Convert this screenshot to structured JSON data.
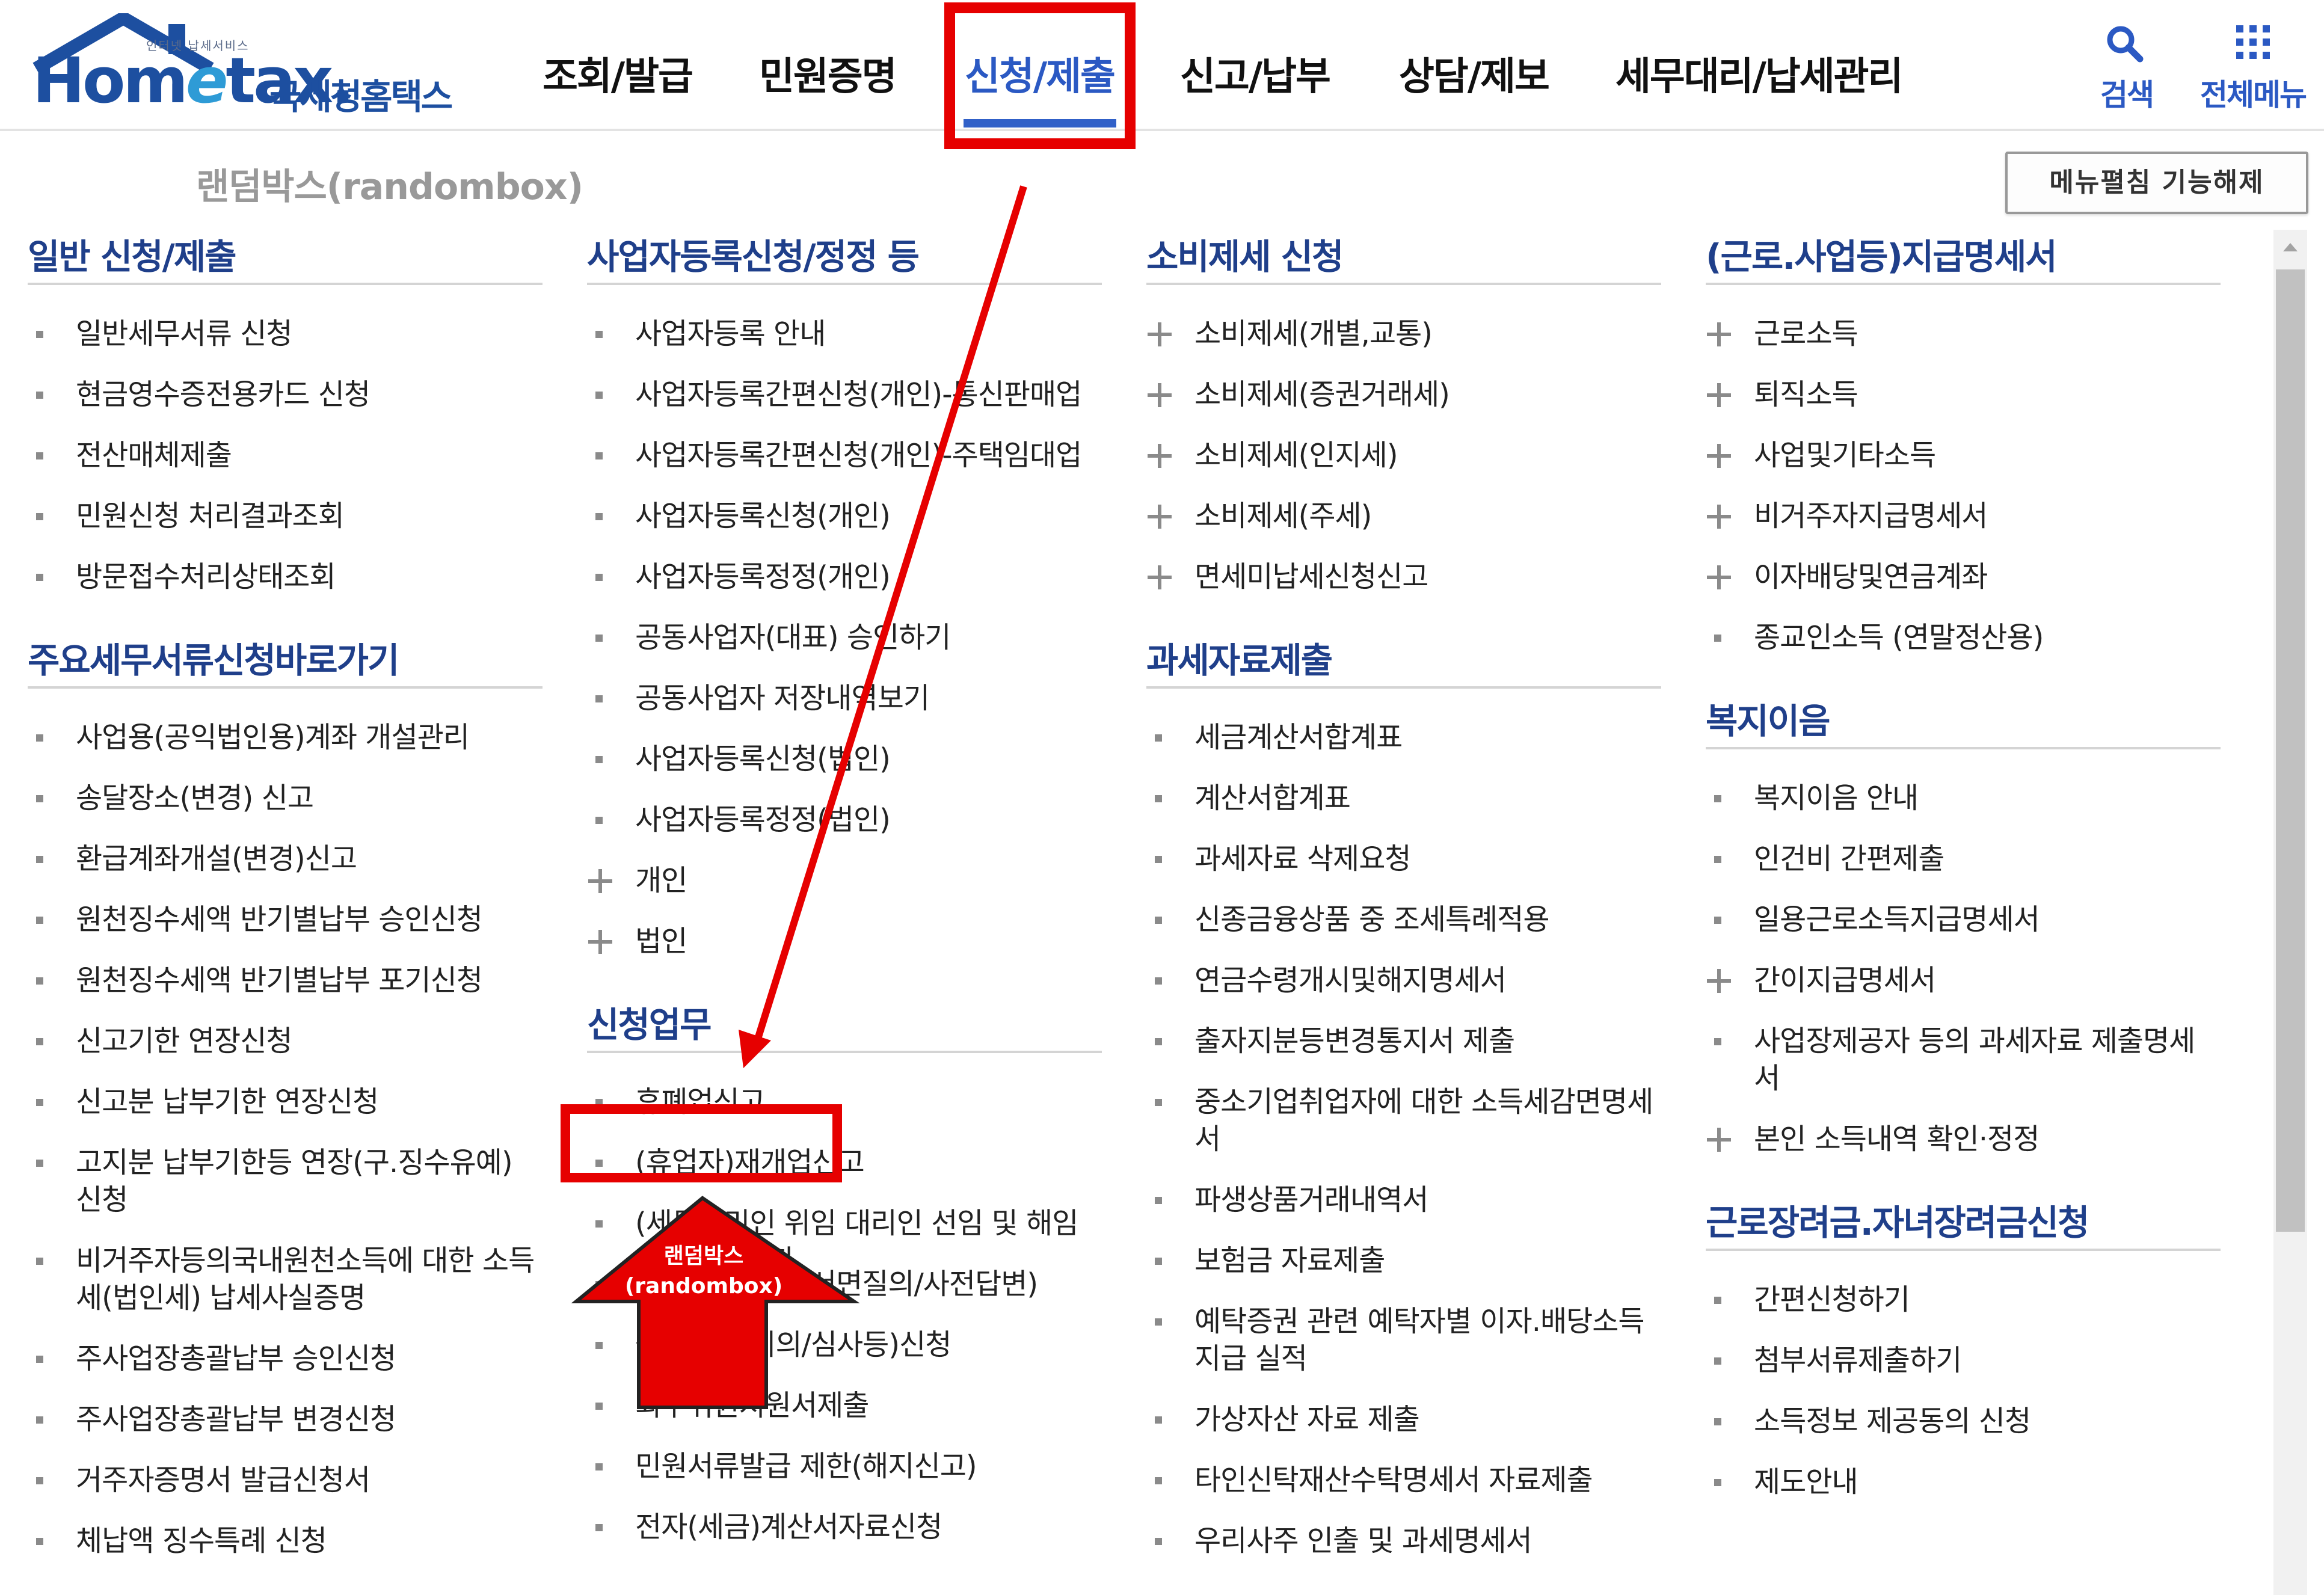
{
  "logo": {
    "tagline": "인터넷 납세서비스",
    "word_a": "Hom",
    "word_e": "e",
    "word_b": "tax.",
    "korean": "국세청홈택스"
  },
  "nav": {
    "items": [
      {
        "label": "조회/발급"
      },
      {
        "label": "민원증명"
      },
      {
        "label": "신청/제출",
        "active": true
      },
      {
        "label": "신고/납부"
      },
      {
        "label": "상담/제보"
      },
      {
        "label": "세무대리/납세관리"
      }
    ],
    "search_label": "검색",
    "all_menu_label": "전체메뉴"
  },
  "sub": {
    "randombox_label": "랜덤박스(randombox)",
    "menu_toggle_label": "메뉴펼침 기능해제"
  },
  "columns": [
    {
      "sections": [
        {
          "title": "일반 신청/제출",
          "items": [
            {
              "label": "일반세무서류 신청",
              "marker": "bullet"
            },
            {
              "label": "현금영수증전용카드 신청",
              "marker": "bullet"
            },
            {
              "label": "전산매체제출",
              "marker": "bullet"
            },
            {
              "label": "민원신청 처리결과조회",
              "marker": "bullet"
            },
            {
              "label": "방문접수처리상태조회",
              "marker": "bullet"
            }
          ]
        },
        {
          "title": "주요세무서류신청바로가기",
          "items": [
            {
              "label": "사업용(공익법인용)계좌 개설관리",
              "marker": "bullet"
            },
            {
              "label": "송달장소(변경) 신고",
              "marker": "bullet"
            },
            {
              "label": "환급계좌개설(변경)신고",
              "marker": "bullet"
            },
            {
              "label": "원천징수세액 반기별납부 승인신청",
              "marker": "bullet"
            },
            {
              "label": "원천징수세액 반기별납부 포기신청",
              "marker": "bullet"
            },
            {
              "label": "신고기한 연장신청",
              "marker": "bullet"
            },
            {
              "label": "신고분 납부기한 연장신청",
              "marker": "bullet"
            },
            {
              "label": "고지분 납부기한등 연장(구.징수유예) 신청",
              "marker": "bullet",
              "lines": 2
            },
            {
              "label": "비거주자등의국내원천소득에 대한 소득세(법인세) 납세사실증명",
              "marker": "bullet",
              "lines": 2
            },
            {
              "label": "주사업장총괄납부 승인신청",
              "marker": "bullet"
            },
            {
              "label": "주사업장총괄납부 변경신청",
              "marker": "bullet"
            },
            {
              "label": "거주자증명서 발급신청서",
              "marker": "bullet"
            },
            {
              "label": "체납액 징수특례 신청",
              "marker": "bullet"
            }
          ]
        }
      ]
    },
    {
      "sections": [
        {
          "title": "사업자등록신청/정정 등",
          "items": [
            {
              "label": "사업자등록 안내",
              "marker": "bullet"
            },
            {
              "label": "사업자등록간편신청(개인)-통신판매업",
              "marker": "bullet"
            },
            {
              "label": "사업자등록간편신청(개인)-주택임대업",
              "marker": "bullet"
            },
            {
              "label": "사업자등록신청(개인)",
              "marker": "bullet"
            },
            {
              "label": "사업자등록정정(개인)",
              "marker": "bullet"
            },
            {
              "label": "공동사업자(대표) 승인하기",
              "marker": "bullet"
            },
            {
              "label": "공동사업자 저장내역보기",
              "marker": "bullet"
            },
            {
              "label": "사업자등록신청(법인)",
              "marker": "bullet"
            },
            {
              "label": "사업자등록정정(법인)",
              "marker": "bullet"
            },
            {
              "label": "개인",
              "marker": "plus"
            },
            {
              "label": "법인",
              "marker": "plus"
            }
          ]
        },
        {
          "title": "신청업무",
          "items": [
            {
              "label": "휴폐업신고",
              "marker": "bullet"
            },
            {
              "label": "(휴업자)재개업신고",
              "marker": "bullet"
            },
            {
              "label": "(세무대리인 위임 대리인 선임 및 해임 등) 신청/해지",
              "marker": "bullet"
            },
            {
              "label": "세법해석 질의(서면질의/사전답변)",
              "marker": "bullet"
            },
            {
              "label": "불복청구(이의/심사등)신청",
              "marker": "bullet"
            },
            {
              "label": "외부위원지원서제출",
              "marker": "bullet"
            },
            {
              "label": "민원서류발급 제한(해지신고)",
              "marker": "bullet"
            },
            {
              "label": "전자(세금)계산서자료신청",
              "marker": "bullet"
            }
          ]
        }
      ]
    },
    {
      "sections": [
        {
          "title": "소비제세 신청",
          "items": [
            {
              "label": "소비제세(개별,교통)",
              "marker": "plus"
            },
            {
              "label": "소비제세(증권거래세)",
              "marker": "plus"
            },
            {
              "label": "소비제세(인지세)",
              "marker": "plus"
            },
            {
              "label": "소비제세(주세)",
              "marker": "plus"
            },
            {
              "label": "면세미납세신청신고",
              "marker": "plus"
            }
          ]
        },
        {
          "title": "과세자료제출",
          "items": [
            {
              "label": "세금계산서합계표",
              "marker": "bullet"
            },
            {
              "label": "계산서합계표",
              "marker": "bullet"
            },
            {
              "label": "과세자료 삭제요청",
              "marker": "bullet"
            },
            {
              "label": "신종금융상품 중 조세특례적용",
              "marker": "bullet"
            },
            {
              "label": "연금수령개시및해지명세서",
              "marker": "bullet"
            },
            {
              "label": "출자지분등변경통지서 제출",
              "marker": "bullet"
            },
            {
              "label": "중소기업취업자에 대한 소득세감면명세서",
              "marker": "bullet",
              "lines": 2
            },
            {
              "label": "파생상품거래내역서",
              "marker": "bullet"
            },
            {
              "label": "보험금 자료제출",
              "marker": "bullet"
            },
            {
              "label": "예탁증권 관련 예탁자별 이자.배당소득 지급 실적",
              "marker": "bullet",
              "lines": 2
            },
            {
              "label": "가상자산 자료 제출",
              "marker": "bullet"
            },
            {
              "label": "타인신탁재산수탁명세서 자료제출",
              "marker": "bullet"
            },
            {
              "label": "우리사주 인출 및 과세명세서",
              "marker": "bullet"
            }
          ]
        }
      ]
    },
    {
      "sections": [
        {
          "title": "(근로.사업등)지급명세서",
          "items": [
            {
              "label": "근로소득",
              "marker": "plus"
            },
            {
              "label": "퇴직소득",
              "marker": "plus"
            },
            {
              "label": "사업및기타소득",
              "marker": "plus"
            },
            {
              "label": "비거주자지급명세서",
              "marker": "plus"
            },
            {
              "label": "이자배당및연금계좌",
              "marker": "plus"
            },
            {
              "label": "종교인소득 (연말정산용)",
              "marker": "bullet"
            }
          ]
        },
        {
          "title": "복지이음",
          "items": [
            {
              "label": "복지이음 안내",
              "marker": "bullet"
            },
            {
              "label": "인건비 간편제출",
              "marker": "bullet"
            },
            {
              "label": "일용근로소득지급명세서",
              "marker": "bullet"
            },
            {
              "label": "간이지급명세서",
              "marker": "plus"
            },
            {
              "label": "사업장제공자 등의 과세자료 제출명세서",
              "marker": "bullet",
              "lines": 2
            },
            {
              "label": "본인 소득내역 확인·정정",
              "marker": "plus"
            }
          ]
        },
        {
          "title": "근로장려금.자녀장려금신청",
          "items": [
            {
              "label": "간편신청하기",
              "marker": "bullet"
            },
            {
              "label": "첨부서류제출하기",
              "marker": "bullet"
            },
            {
              "label": "소득정보 제공동의 신청",
              "marker": "bullet"
            },
            {
              "label": "제도안내",
              "marker": "bullet"
            }
          ]
        }
      ]
    }
  ],
  "annotation": {
    "arrow_label_line1": "랜덤박스",
    "arrow_label_line2": "(randombox)",
    "color": "#e60000"
  },
  "colors": {
    "brand_blue": "#1d4fa0",
    "active_blue": "#2b59c3",
    "section_title": "#1f3f8a",
    "highlight_red": "#e60000"
  }
}
